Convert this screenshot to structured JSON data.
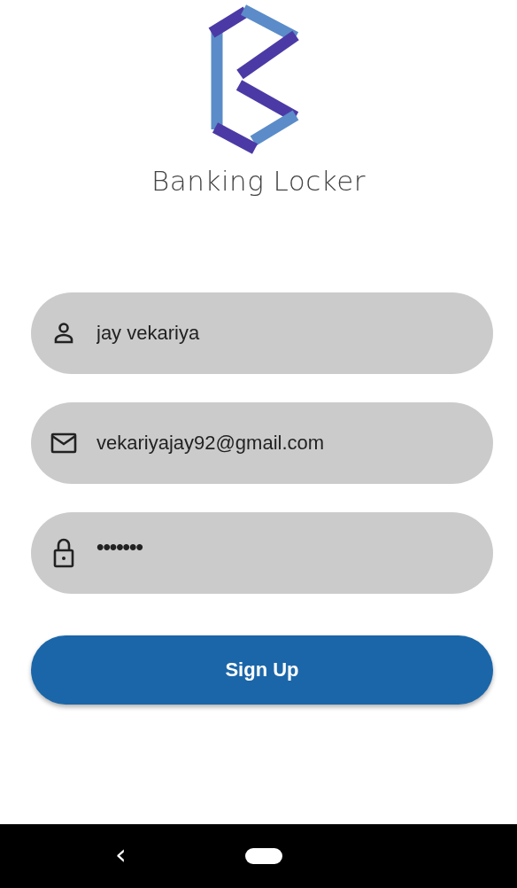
{
  "app": {
    "name": "Banking Locker"
  },
  "fields": [
    {
      "kind": "person",
      "value": "jay vekariya"
    },
    {
      "kind": "email",
      "value": "vekariyajay92@gmail.com"
    },
    {
      "kind": "lock",
      "value": "•••••••"
    }
  ],
  "button": {
    "label": "Sign Up"
  },
  "nav_bar": {
    "back": "‹"
  }
}
